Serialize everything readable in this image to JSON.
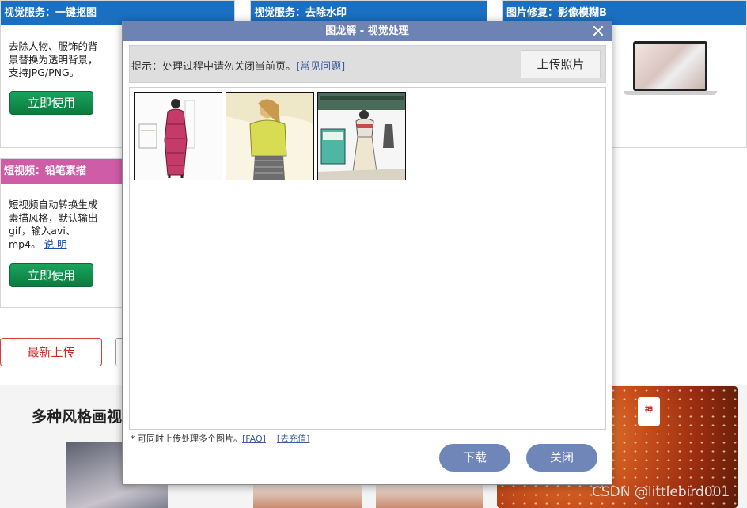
{
  "cards": [
    {
      "title": "视觉服务：一键抠图",
      "desc": "去除人物、服饰的背景替换为透明背景，支持JPG/PNG。",
      "button": "立即使用"
    },
    {
      "title": "视觉服务：去除水印"
    },
    {
      "title": "图片修复：影像模糊B"
    },
    {
      "title": "短视频：铅笔素描",
      "desc": "短视频自动转换生成素描风格，默认输出gif，输入avi、mp4。",
      "link": "说 明",
      "button": "立即使用"
    }
  ],
  "latest_upload": "最新上传",
  "section_title": "多种风格画视",
  "seal_text": "神龙",
  "watermark": "CSDN @littlebird001",
  "modal": {
    "title": "图龙解 - 视觉处理",
    "tip": "提示：处理过程中请勿关闭当前页。",
    "faq_link": "[常见问题]",
    "upload_button": "上传照片",
    "footnote": "* 可同时上传处理多个图片。",
    "footnote_faq": "[FAQ]",
    "footnote_recharge": "[去充值]",
    "download_button": "下载",
    "close_button": "关闭",
    "thumbnails": [
      {
        "name": "sketch-woman-red-coat"
      },
      {
        "name": "sketch-woman-yellow-top"
      },
      {
        "name": "sketch-woman-street"
      }
    ]
  },
  "colors": {
    "blue_header": "#1a6fc0",
    "pink_header": "#cf5ca7",
    "modal_title": "#6d83b4",
    "pill_button": "#7086b8",
    "green_button": "#0b7a3e"
  }
}
